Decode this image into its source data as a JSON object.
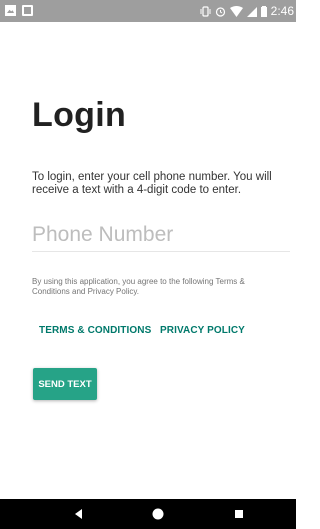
{
  "status_bar": {
    "time": "2:46",
    "left_icons": [
      "image-icon",
      "notification-icon"
    ],
    "right_icons": [
      "vibrate-icon",
      "alarm-icon",
      "wifi-icon",
      "signal-icon",
      "battery-icon"
    ]
  },
  "login": {
    "title": "Login",
    "intro": "To login, enter your cell phone number. You will receive a text with a 4-digit code to enter.",
    "phone_placeholder": "Phone Number",
    "phone_value": "",
    "terms_notice": "By using this application, you agree to the following Terms & Conditions and Privacy Policy.",
    "terms_link": "TERMS & CONDITIONS",
    "privacy_link": "PRIVACY POLICY",
    "send_button": "SEND TEXT"
  },
  "nav_bar": {
    "icons": [
      "back-icon",
      "home-icon",
      "recents-icon"
    ]
  },
  "colors": {
    "accent": "#26a387",
    "link": "#00796b",
    "status_bar": "#9e9e9e",
    "nav_bar": "#000000"
  }
}
